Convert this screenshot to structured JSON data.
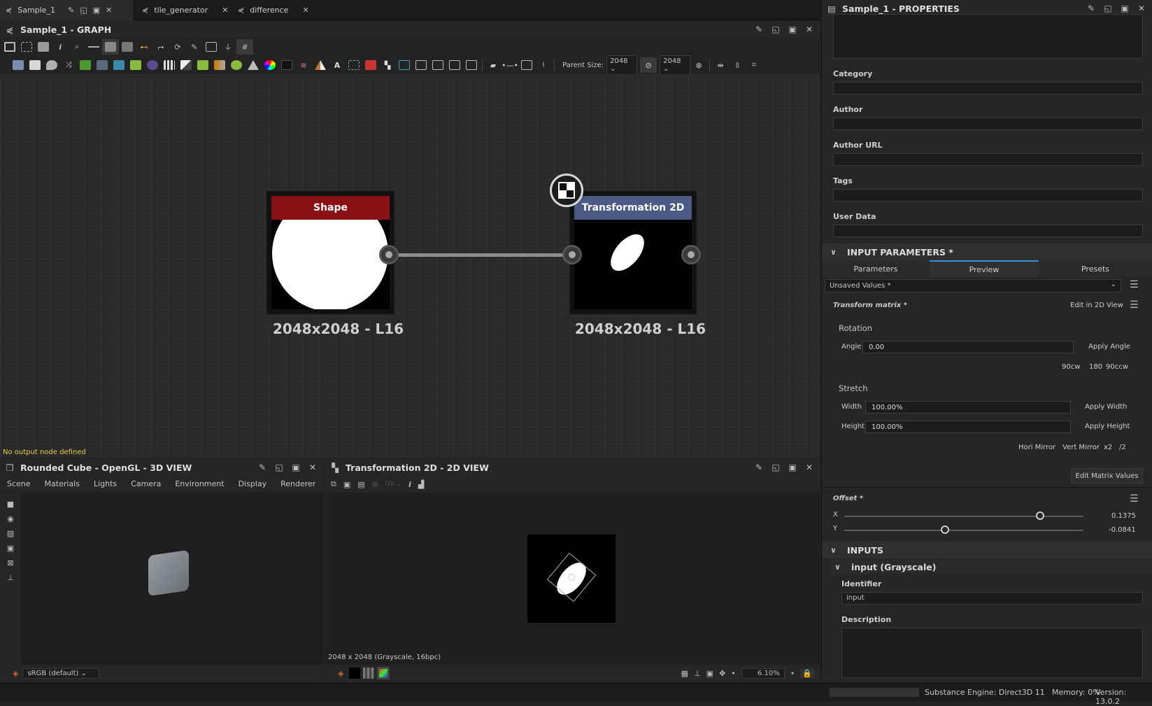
{
  "tabs": [
    {
      "label": "Sample_1",
      "active": true
    },
    {
      "label": "tile_generator"
    },
    {
      "label": "difference"
    }
  ],
  "graph_panel": {
    "title": "Sample_1 - GRAPH",
    "parent_size_label": "Parent Size:",
    "parent_size_w": "2048",
    "parent_size_h": "2048",
    "warning": "No output node defined"
  },
  "nodes": {
    "shape": {
      "title": "Shape",
      "caption": "2048x2048 - L16",
      "color": "#8b1014"
    },
    "transform": {
      "title": "Transformation 2D",
      "caption": "2048x2048 - L16",
      "color": "#4b5a85"
    }
  },
  "props": {
    "title": "Sample_1 - PROPERTIES",
    "labels": {
      "category": "Category",
      "author": "Author",
      "author_url": "Author URL",
      "tags": "Tags",
      "user_data": "User Data"
    },
    "input_params": {
      "title": "INPUT PARAMETERS *",
      "tabs": [
        "Parameters",
        "Preview",
        "Presets"
      ],
      "active_tab": "Preview",
      "preset": "Unsaved Values *"
    },
    "transform_matrix": {
      "label": "Transform matrix *",
      "edit_link": "Edit in 2D View",
      "rotation": "Rotation",
      "angle_label": "Angle",
      "angle_value": "0.00",
      "apply_angle": "Apply Angle",
      "rot_90cw": "90cw",
      "rot_180": "180",
      "rot_90ccw": "90ccw",
      "stretch": "Stretch",
      "width_label": "Width",
      "width_value": "100.00%",
      "apply_width": "Apply Width",
      "height_label": "Height",
      "height_value": "100.00%",
      "apply_height": "Apply Height",
      "hori_mirror": "Hori Mirror",
      "vert_mirror": "Vert Mirror",
      "x2": "x2",
      "div2": "/2",
      "edit_matrix": "Edit Matrix Values"
    },
    "offset": {
      "label": "Offset *",
      "x_label": "X",
      "x_value": "0.1375",
      "x_level": 0.82,
      "y_label": "Y",
      "y_value": "-0.0841",
      "y_level": 0.42
    },
    "inputs": {
      "title": "INPUTS",
      "sub": "input (Grayscale)",
      "identifier_label": "Identifier",
      "identifier_value": "input",
      "description_label": "Description"
    }
  },
  "view3d": {
    "title": "Rounded Cube - OpenGL - 3D VIEW",
    "menu": [
      "Scene",
      "Materials",
      "Lights",
      "Camera",
      "Environment",
      "Display",
      "Renderer"
    ],
    "colorspace": "sRGB (default)"
  },
  "view2d": {
    "title": "Transformation 2D - 2D VIEW",
    "uv": "UV",
    "info": "2048 x 2048 (Grayscale, 16bpc)",
    "zoom": "6.10%"
  },
  "status": {
    "engine": "Substance Engine: Direct3D 11",
    "memory": "Memory: 0%",
    "version": "Version: 13.0.2"
  }
}
